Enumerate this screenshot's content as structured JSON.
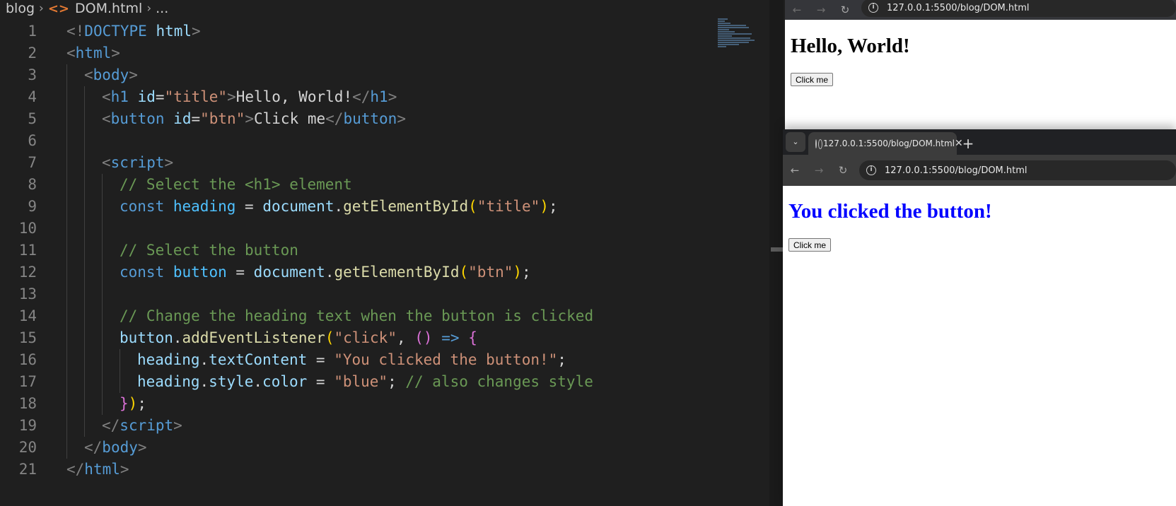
{
  "breadcrumb": {
    "folder": "blog",
    "file": "DOM.html",
    "rest": "..."
  },
  "editor": {
    "colors": {
      "background": "#1f1f1f",
      "tag": "#569cd6",
      "string": "#ce9178",
      "comment": "#6a9955"
    },
    "lines": [
      {
        "n": "1",
        "indent": 0,
        "tokens": [
          [
            "pu",
            "<!"
          ],
          [
            "tg",
            "DOCTYPE"
          ],
          [
            "tx",
            " "
          ],
          [
            "at",
            "html"
          ],
          [
            "pu",
            ">"
          ]
        ]
      },
      {
        "n": "2",
        "indent": 0,
        "tokens": [
          [
            "pu",
            "<"
          ],
          [
            "tg",
            "html"
          ],
          [
            "pu",
            ">"
          ]
        ]
      },
      {
        "n": "3",
        "indent": 1,
        "tokens": [
          [
            "pu",
            "<"
          ],
          [
            "tg",
            "body"
          ],
          [
            "pu",
            ">"
          ]
        ]
      },
      {
        "n": "4",
        "indent": 2,
        "tokens": [
          [
            "pu",
            "<"
          ],
          [
            "tg",
            "h1"
          ],
          [
            "tx",
            " "
          ],
          [
            "at",
            "id"
          ],
          [
            "tx",
            "="
          ],
          [
            "st",
            "\"title\""
          ],
          [
            "pu",
            ">"
          ],
          [
            "tx",
            "Hello, World!"
          ],
          [
            "pu",
            "</"
          ],
          [
            "tg",
            "h1"
          ],
          [
            "pu",
            ">"
          ]
        ]
      },
      {
        "n": "5",
        "indent": 2,
        "tokens": [
          [
            "pu",
            "<"
          ],
          [
            "tg",
            "button"
          ],
          [
            "tx",
            " "
          ],
          [
            "at",
            "id"
          ],
          [
            "tx",
            "="
          ],
          [
            "st",
            "\"btn\""
          ],
          [
            "pu",
            ">"
          ],
          [
            "tx",
            "Click me"
          ],
          [
            "pu",
            "</"
          ],
          [
            "tg",
            "button"
          ],
          [
            "pu",
            ">"
          ]
        ]
      },
      {
        "n": "6",
        "indent": 2,
        "tokens": []
      },
      {
        "n": "7",
        "indent": 2,
        "tokens": [
          [
            "pu",
            "<"
          ],
          [
            "tg",
            "script"
          ],
          [
            "pu",
            ">"
          ]
        ]
      },
      {
        "n": "8",
        "indent": 3,
        "tokens": [
          [
            "cm",
            "// Select the <h1> element"
          ]
        ]
      },
      {
        "n": "9",
        "indent": 3,
        "tokens": [
          [
            "kw",
            "const"
          ],
          [
            "tx",
            " "
          ],
          [
            "va",
            "heading"
          ],
          [
            "tx",
            " = "
          ],
          [
            "pr",
            "document"
          ],
          [
            "tx",
            "."
          ],
          [
            "fn",
            "getElementById"
          ],
          [
            "b1",
            "("
          ],
          [
            "st",
            "\"title\""
          ],
          [
            "b1",
            ")"
          ],
          [
            "tx",
            ";"
          ]
        ]
      },
      {
        "n": "10",
        "indent": 3,
        "tokens": []
      },
      {
        "n": "11",
        "indent": 3,
        "tokens": [
          [
            "cm",
            "// Select the button"
          ]
        ]
      },
      {
        "n": "12",
        "indent": 3,
        "tokens": [
          [
            "kw",
            "const"
          ],
          [
            "tx",
            " "
          ],
          [
            "va",
            "button"
          ],
          [
            "tx",
            " = "
          ],
          [
            "pr",
            "document"
          ],
          [
            "tx",
            "."
          ],
          [
            "fn",
            "getElementById"
          ],
          [
            "b1",
            "("
          ],
          [
            "st",
            "\"btn\""
          ],
          [
            "b1",
            ")"
          ],
          [
            "tx",
            ";"
          ]
        ]
      },
      {
        "n": "13",
        "indent": 3,
        "tokens": []
      },
      {
        "n": "14",
        "indent": 3,
        "tokens": [
          [
            "cm",
            "// Change the heading text when the button is clicked"
          ]
        ]
      },
      {
        "n": "15",
        "indent": 3,
        "tokens": [
          [
            "pr",
            "button"
          ],
          [
            "tx",
            "."
          ],
          [
            "fn",
            "addEventListener"
          ],
          [
            "b1",
            "("
          ],
          [
            "st",
            "\"click\""
          ],
          [
            "tx",
            ", "
          ],
          [
            "b2",
            "()"
          ],
          [
            "tx",
            " "
          ],
          [
            "ar",
            "=>"
          ],
          [
            "tx",
            " "
          ],
          [
            "b2",
            "{"
          ]
        ]
      },
      {
        "n": "16",
        "indent": 4,
        "tokens": [
          [
            "pr",
            "heading"
          ],
          [
            "tx",
            "."
          ],
          [
            "pr",
            "textContent"
          ],
          [
            "tx",
            " = "
          ],
          [
            "st",
            "\"You clicked the button!\""
          ],
          [
            "tx",
            ";"
          ]
        ]
      },
      {
        "n": "17",
        "indent": 4,
        "tokens": [
          [
            "pr",
            "heading"
          ],
          [
            "tx",
            "."
          ],
          [
            "pr",
            "style"
          ],
          [
            "tx",
            "."
          ],
          [
            "pr",
            "color"
          ],
          [
            "tx",
            " = "
          ],
          [
            "st",
            "\"blue\""
          ],
          [
            "tx",
            "; "
          ],
          [
            "cm",
            "// also changes style"
          ]
        ]
      },
      {
        "n": "18",
        "indent": 3,
        "tokens": [
          [
            "b2",
            "}"
          ],
          [
            "b1",
            ")"
          ],
          [
            "tx",
            ";"
          ]
        ]
      },
      {
        "n": "19",
        "indent": 2,
        "tokens": [
          [
            "pu",
            "</"
          ],
          [
            "tg",
            "script"
          ],
          [
            "pu",
            ">"
          ]
        ]
      },
      {
        "n": "20",
        "indent": 1,
        "tokens": [
          [
            "pu",
            "</"
          ],
          [
            "tg",
            "body"
          ],
          [
            "pu",
            ">"
          ]
        ]
      },
      {
        "n": "21",
        "indent": 0,
        "tokens": [
          [
            "pu",
            "</"
          ],
          [
            "tg",
            "html"
          ],
          [
            "pu",
            ">"
          ]
        ]
      }
    ]
  },
  "browser_back": {
    "url": "127.0.0.1:5500/blog/DOM.html",
    "heading": "Hello, World!",
    "button_label": "Click me"
  },
  "browser_front": {
    "tab_title": "127.0.0.1:5500/blog/DOM.html",
    "tab_close": "✕",
    "new_tab": "+",
    "url": "127.0.0.1:5500/blog/DOM.html",
    "heading": "You clicked the button!",
    "heading_color": "#0000ff",
    "button_label": "Click me"
  },
  "icons": {
    "back": "←",
    "forward": "→",
    "reload": "↻",
    "tab_menu": "⌄",
    "info": "i",
    "folder_sep": "›",
    "file": "<>"
  }
}
